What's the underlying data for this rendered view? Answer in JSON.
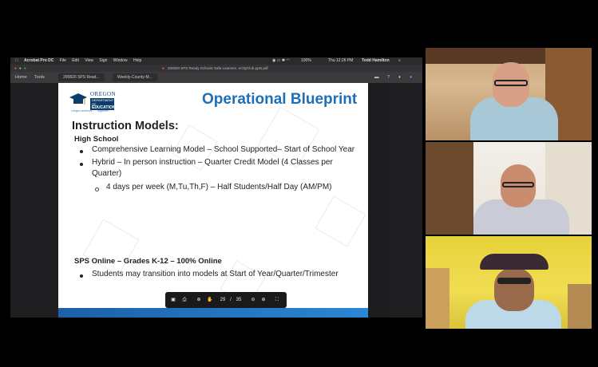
{
  "menubar": {
    "app": "Acrobat Pro DC",
    "items": [
      "File",
      "Edit",
      "View",
      "Sign",
      "Window",
      "Help"
    ],
    "battery": "100%",
    "clock": "Thu 12:26 PM",
    "user": "Todd Hamilton"
  },
  "window": {
    "title": "200820 SPS Ready Schools Safe Learners. eCityClub.ppts.pdf"
  },
  "toolbar": {
    "home": "Home",
    "tools": "Tools",
    "tabs": [
      "200820 SPS Read...",
      "Weekly-County-M..."
    ]
  },
  "slide": {
    "logo": {
      "line1": "OREGON",
      "line2a": "DEPARTMENT OF",
      "line2b": "EDUCATION",
      "tagline": "Oregon achieves . . . together!"
    },
    "title": "Operational Blueprint",
    "section_heading": "Instruction Models:",
    "subhead": "High School",
    "bullets": [
      "Comprehensive Learning Model – School Supported– Start of School Year",
      "Hybrid – In person instruction – Quarter Credit Model (4 Classes per",
      "Quarter)"
    ],
    "sub_bullet": "4 days per week (M,Tu,Th,F) – Half Students/Half Day (AM/PM)",
    "sps_heading": "SPS Online – Grades K-12 – 100% Online",
    "sps_bullet": "Students may transition into models at Start of Year/Quarter/Trimester"
  },
  "pagebar": {
    "current": "29",
    "separator": "/",
    "total": "35"
  },
  "colors": {
    "title_blue": "#1f6fb7",
    "footer_blue": "#1d5fa8",
    "ode_navy": "#0a3d6b"
  }
}
